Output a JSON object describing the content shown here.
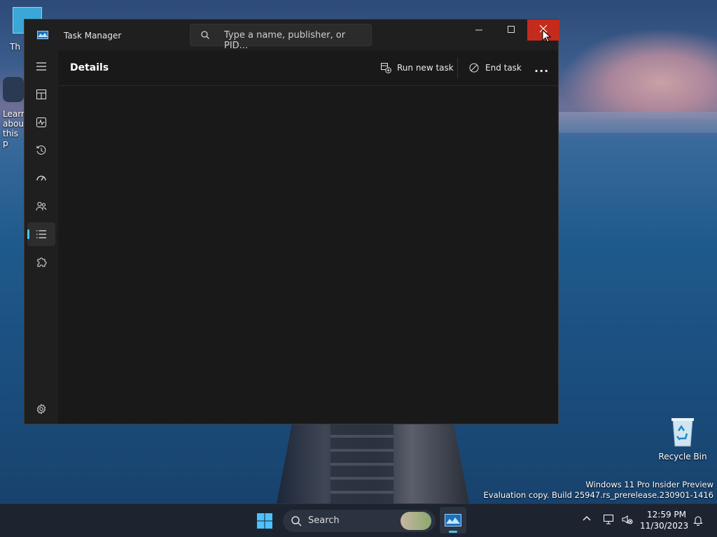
{
  "desktop": {
    "icons": [
      {
        "label": "Th"
      },
      {
        "label": "Learn about this p"
      },
      {
        "label": "Recycle Bin"
      }
    ],
    "watermark": {
      "line1": "Windows 11 Pro Insider Preview",
      "line2": "Evaluation copy. Build 25947.rs_prerelease.230901-1416"
    }
  },
  "window": {
    "title": "Task Manager",
    "search_placeholder": "Type a name, publisher, or PID...",
    "page_title": "Details",
    "commands": {
      "run_new_task": "Run new task",
      "end_task": "End task",
      "more": "..."
    },
    "nav": [
      {
        "name": "menu",
        "active": false
      },
      {
        "name": "processes",
        "active": false
      },
      {
        "name": "performance",
        "active": false
      },
      {
        "name": "app-history",
        "active": false
      },
      {
        "name": "startup-apps",
        "active": false
      },
      {
        "name": "users",
        "active": false
      },
      {
        "name": "details",
        "active": true
      },
      {
        "name": "services",
        "active": false
      },
      {
        "name": "settings",
        "active": false
      }
    ]
  },
  "taskbar": {
    "search_label": "Search",
    "time": "12:59 PM",
    "date": "11/30/2023"
  },
  "colors": {
    "accent": "#4cc2ff",
    "close_hover": "#c42b1c"
  }
}
